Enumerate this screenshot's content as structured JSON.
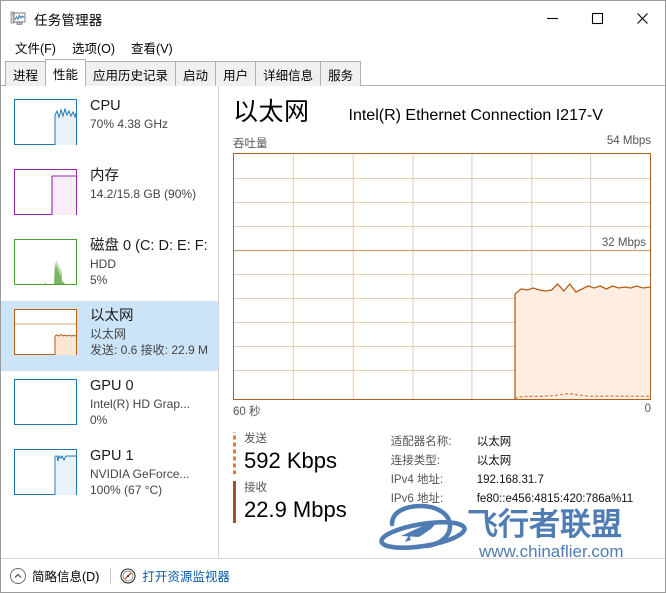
{
  "window": {
    "title": "任务管理器",
    "icon": "task-manager-icon",
    "minimize": "—",
    "maximize": "□",
    "close": "✕"
  },
  "menu": {
    "items": [
      {
        "label": "文件(F)"
      },
      {
        "label": "选项(O)"
      },
      {
        "label": "查看(V)"
      }
    ]
  },
  "tabs": {
    "items": [
      {
        "label": "进程",
        "active": false
      },
      {
        "label": "性能",
        "active": true
      },
      {
        "label": "应用历史记录",
        "active": false
      },
      {
        "label": "启动",
        "active": false
      },
      {
        "label": "用户",
        "active": false
      },
      {
        "label": "详细信息",
        "active": false
      },
      {
        "label": "服务",
        "active": false
      }
    ]
  },
  "sidebar": {
    "items": [
      {
        "name": "cpu",
        "title": "CPU",
        "line2": "70% 4.38 GHz",
        "line3": "",
        "color": "#1e78b4",
        "selected": false
      },
      {
        "name": "memory",
        "title": "内存",
        "line2": "14.2/15.8 GB (90%)",
        "line3": "",
        "color": "#9a23b0",
        "selected": false
      },
      {
        "name": "disk",
        "title": "磁盘 0 (C: D: E: F:",
        "line2": "HDD",
        "line3": "5%",
        "color": "#4c9e2f",
        "selected": false
      },
      {
        "name": "ethernet",
        "title": "以太网",
        "line2": "以太网",
        "line3": "发送: 0.6 接收: 22.9 M",
        "color": "#b25f17",
        "selected": true
      },
      {
        "name": "gpu0",
        "title": "GPU 0",
        "line2": "Intel(R) HD Grap...",
        "line3": "0%",
        "color": "#1e78b4",
        "selected": false
      },
      {
        "name": "gpu1",
        "title": "GPU 1",
        "line2": "NVIDIA GeForce...",
        "line3": "100% (67 °C)",
        "color": "#1e78b4",
        "selected": false
      }
    ]
  },
  "main": {
    "title": "以太网",
    "adapter_title": "Intel(R) Ethernet Connection I217-V",
    "graph_label": "吞吐量",
    "graph_max": "54 Mbps",
    "graph_mid_label": "32 Mbps",
    "time_left": "60 秒",
    "time_right": "0",
    "send": {
      "label": "发送",
      "value": "592 Kbps"
    },
    "receive": {
      "label": "接收",
      "value": "22.9 Mbps"
    },
    "info": [
      {
        "key": "适配器名称:",
        "value": "以太网"
      },
      {
        "key": "连接类型:",
        "value": "以太网"
      },
      {
        "key": "IPv4 地址:",
        "value": "192.168.31.7"
      },
      {
        "key": "IPv6 地址:",
        "value": "fe80::e456:4815:420:786a%11"
      }
    ]
  },
  "footer": {
    "fewer_details": "简略信息(D)",
    "resource_monitor": "打开资源监视器"
  },
  "watermark": {
    "brand": "飞行者联盟",
    "url": "www.chinaflier.com",
    "color": "#4a78b0"
  },
  "chart_data": {
    "type": "area",
    "title": "吞吐量",
    "ylabel": "",
    "xlabel": "",
    "ylim": [
      0,
      54
    ],
    "yticks": [
      0,
      32,
      54
    ],
    "ytick_labels": [
      "0",
      "32 Mbps",
      "54 Mbps"
    ],
    "xlim": [
      60,
      0
    ],
    "xtick_labels": [
      "60 秒",
      "0"
    ],
    "grid": true,
    "grid_rows": 10,
    "grid_cols": 7,
    "line_color": "#b25f17",
    "fill_color": "#fdeee1",
    "series": [
      {
        "name": "接收",
        "unit": "Mbps",
        "x": [
          60,
          59,
          58,
          57,
          56,
          55,
          54,
          53,
          52,
          51,
          50,
          49,
          48,
          47,
          46,
          45,
          44,
          43,
          42,
          41,
          40,
          39,
          38,
          37,
          36,
          35,
          34,
          33,
          32,
          31,
          30,
          29,
          28,
          27,
          26,
          25,
          24,
          23,
          22,
          21,
          20,
          19,
          18,
          17,
          16,
          15,
          14,
          13,
          12,
          11,
          10,
          9,
          8,
          7,
          6,
          5,
          4,
          3,
          2,
          1,
          0
        ],
        "values": [
          0,
          0,
          0,
          0,
          0,
          0,
          0,
          0,
          0,
          0,
          0,
          0,
          0,
          0,
          0,
          0,
          0,
          0,
          0,
          0,
          0,
          0,
          0,
          0,
          0,
          0,
          0,
          0,
          0,
          0,
          0,
          0,
          0,
          0,
          0,
          0,
          0,
          0,
          0,
          0,
          0,
          0.3,
          21.8,
          22.6,
          22.9,
          23.1,
          22.8,
          22.6,
          22.9,
          23.2,
          24.1,
          23.3,
          22.8,
          23.9,
          22.6,
          22.9,
          23.4,
          23.1,
          22.8,
          23.3,
          23.0
        ]
      },
      {
        "name": "发送",
        "unit": "Kbps",
        "x": [
          60,
          59,
          58,
          57,
          56,
          55,
          54,
          53,
          52,
          51,
          50,
          49,
          48,
          47,
          46,
          45,
          44,
          43,
          42,
          41,
          40,
          39,
          38,
          37,
          36,
          35,
          34,
          33,
          32,
          31,
          30,
          29,
          28,
          27,
          26,
          25,
          24,
          23,
          22,
          21,
          20,
          19,
          18,
          17,
          16,
          15,
          14,
          13,
          12,
          11,
          10,
          9,
          8,
          7,
          6,
          5,
          4,
          3,
          2,
          1,
          0
        ],
        "values": [
          0,
          0,
          0,
          0,
          0,
          0,
          0,
          0,
          0,
          0,
          0,
          0,
          0,
          0,
          0,
          0,
          0,
          0,
          0,
          0,
          0,
          0,
          0,
          0,
          0,
          0,
          0,
          0,
          0,
          0,
          0,
          0,
          0,
          0,
          0,
          0,
          0,
          0,
          0,
          0,
          0,
          0,
          0.4,
          0.5,
          0.5,
          0.6,
          0.5,
          0.9,
          1.3,
          0.9,
          0.6,
          0.5,
          0.5,
          0.6,
          0.5,
          0.6,
          0.5,
          0.6,
          0.6,
          0.5,
          0.6
        ]
      }
    ]
  }
}
